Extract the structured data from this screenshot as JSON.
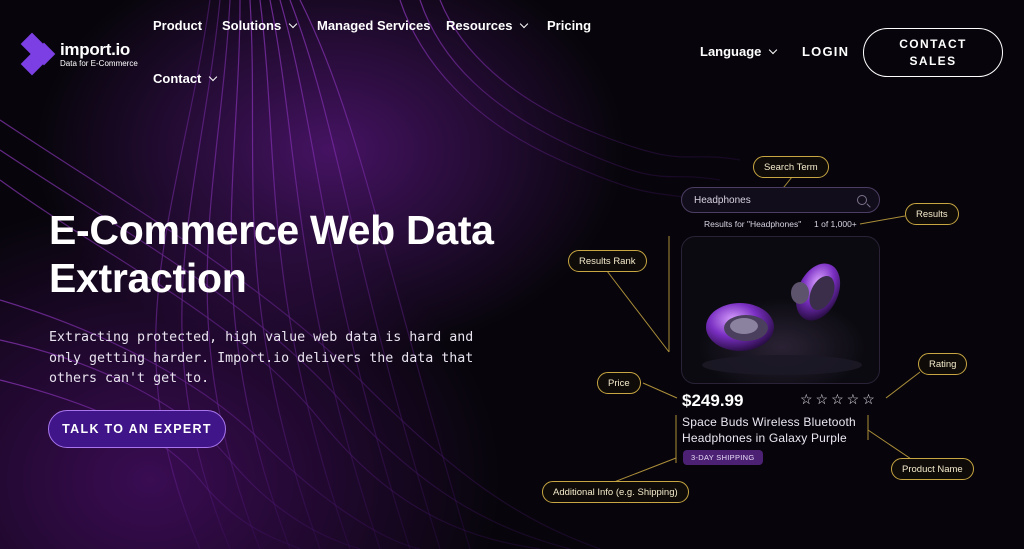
{
  "brand": {
    "name": "import.io",
    "tagline": "Data for E-Commerce"
  },
  "nav": {
    "product": "Product",
    "solutions": "Solutions",
    "managed_services": "Managed Services",
    "resources": "Resources",
    "pricing": "Pricing",
    "contact": "Contact",
    "language": "Language",
    "login": "LOGIN",
    "contact_sales": "CONTACT SALES"
  },
  "hero": {
    "title": "E-Commerce Web Data Extraction",
    "subtitle": "Extracting protected, high value web data is hard and only getting harder. Import.io delivers the data that others can't get to.",
    "cta": "TALK TO AN EXPERT"
  },
  "mock": {
    "search_value": "Headphones",
    "results_text": "Results for \"Headphones\"",
    "results_count": "1 of 1,000+",
    "price": "$249.99",
    "stars": "☆☆☆☆☆",
    "product_name": "Space Buds Wireless Bluetooth Headphones in Galaxy Purple",
    "shipping_badge": "3-DAY SHIPPING"
  },
  "annotations": {
    "search_term": "Search Term",
    "results": "Results",
    "results_rank": "Results Rank",
    "rating": "Rating",
    "price": "Price",
    "product_name": "Product Name",
    "additional_info": "Additional Info (e.g. Shipping)"
  },
  "colors": {
    "accent_purple": "#7b3fe4",
    "cta_bg": "#3f1589",
    "annotation_gold": "#c8a642",
    "background": "#07050b"
  },
  "icons": {
    "logo": "logo-diamond-icon",
    "dropdown": "chevron-down-icon",
    "search": "search-icon",
    "rating": "star-icon"
  }
}
